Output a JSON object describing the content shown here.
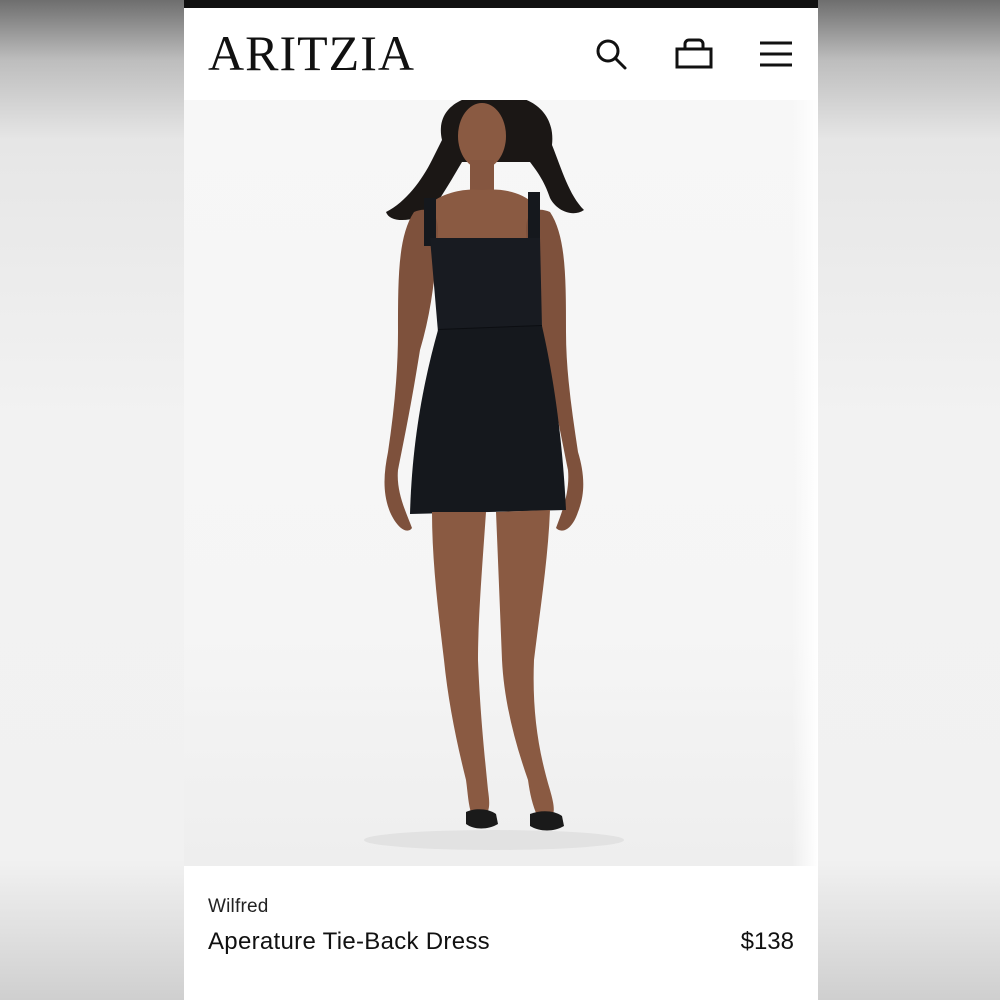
{
  "header": {
    "logo": "ARITZIA",
    "icons": [
      "search-icon",
      "shopping-bag-icon",
      "menu-icon"
    ]
  },
  "product": {
    "brand": "Wilfred",
    "name": "Aperature Tie-Back Dress",
    "price": "$138",
    "image_subject": "model-in-black-mini-dress"
  },
  "colors": {
    "text": "#111111",
    "background": "#ffffff",
    "dress": "#15181d"
  }
}
